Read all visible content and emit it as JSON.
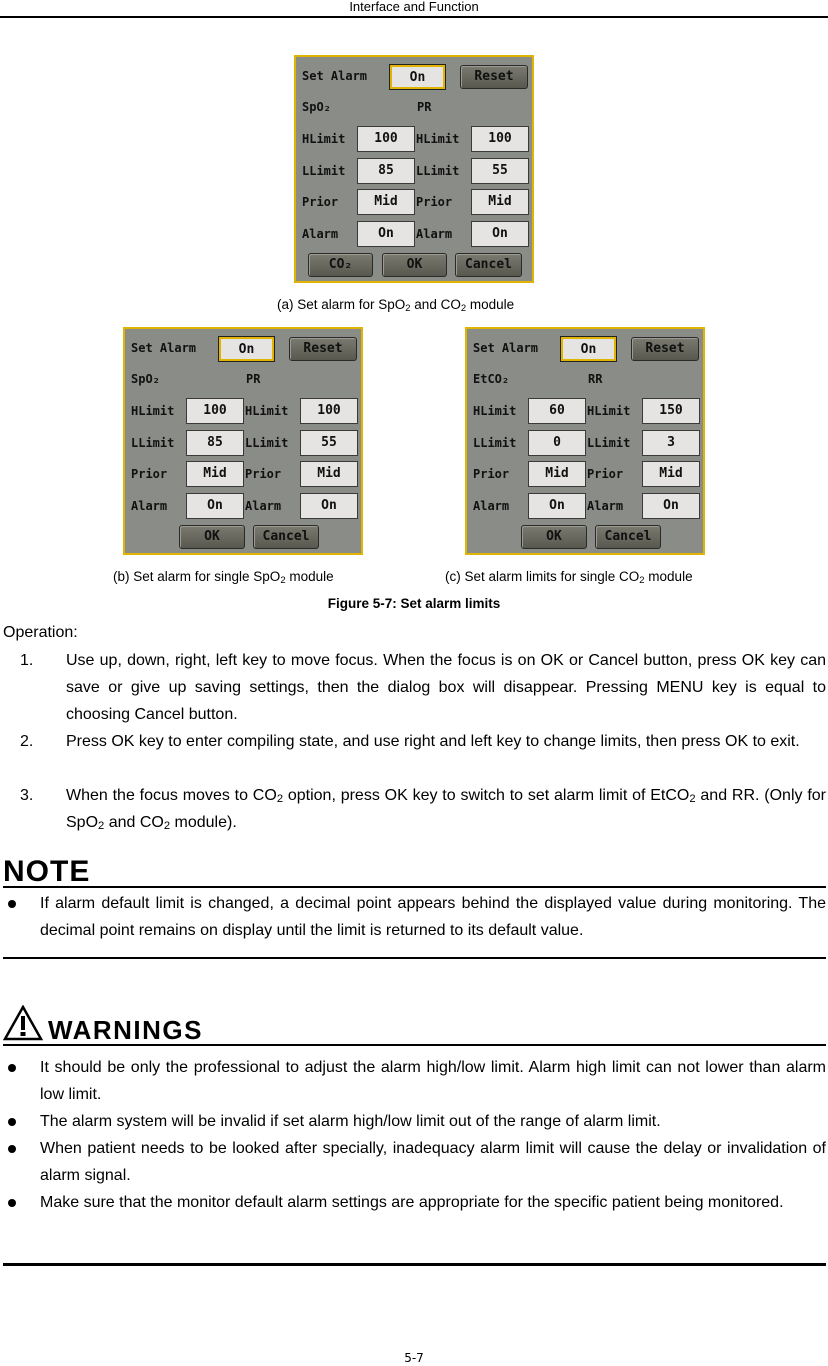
{
  "header": {
    "title": "Interface and Function"
  },
  "dialogs": {
    "a": {
      "set_alarm_label": "Set Alarm",
      "set_alarm_value": "On",
      "reset_label": "Reset",
      "left_param": "SpO₂",
      "right_param": "PR",
      "hlimit_label": "HLimit",
      "llimit_label": "LLimit",
      "prior_label": "Prior",
      "alarm_label": "Alarm",
      "left": {
        "hlimit": "100",
        "llimit": "85",
        "prior": "Mid",
        "alarm": "On"
      },
      "right": {
        "hlimit": "100",
        "llimit": "55",
        "prior": "Mid",
        "alarm": "On"
      },
      "co2_label": "CO₂",
      "ok_label": "OK",
      "cancel_label": "Cancel"
    },
    "b": {
      "set_alarm_label": "Set Alarm",
      "set_alarm_value": "On",
      "reset_label": "Reset",
      "left_param": "SpO₂",
      "right_param": "PR",
      "hlimit_label": "HLimit",
      "llimit_label": "LLimit",
      "prior_label": "Prior",
      "alarm_label": "Alarm",
      "left": {
        "hlimit": "100",
        "llimit": "85",
        "prior": "Mid",
        "alarm": "On"
      },
      "right": {
        "hlimit": "100",
        "llimit": "55",
        "prior": "Mid",
        "alarm": "On"
      },
      "ok_label": "OK",
      "cancel_label": "Cancel"
    },
    "c": {
      "set_alarm_label": "Set Alarm",
      "set_alarm_value": "On",
      "reset_label": "Reset",
      "left_param": "EtCO₂",
      "right_param": "RR",
      "hlimit_label": "HLimit",
      "llimit_label": "LLimit",
      "prior_label": "Prior",
      "alarm_label": "Alarm",
      "left": {
        "hlimit": "60",
        "llimit": "0",
        "prior": "Mid",
        "alarm": "On"
      },
      "right": {
        "hlimit": "150",
        "llimit": "3",
        "prior": "Mid",
        "alarm": "On"
      },
      "ok_label": "OK",
      "cancel_label": "Cancel"
    }
  },
  "captions": {
    "a": {
      "pre": "(a) Set alarm for SpO",
      "sub1": "2",
      "mid": " and CO",
      "sub2": "2",
      "post": " module"
    },
    "b": {
      "pre": "(b) Set alarm for single SpO",
      "sub1": "2",
      "post": " module"
    },
    "c": {
      "pre": "(c) Set alarm limits for single CO",
      "sub1": "2",
      "post": " module"
    }
  },
  "figure_title": "Figure 5-7: Set alarm limits",
  "operation": {
    "heading": "Operation:",
    "steps": [
      {
        "num": "1.",
        "text": "Use up, down, right, left key to move focus. When the focus is on OK or Cancel button, press OK key can save or give up saving settings, then the dialog box will disappear. Pressing MENU key is equal to choosing Cancel button."
      },
      {
        "num": "2.",
        "text": "Press OK key to enter compiling state, and use right and left key to change limits, then press OK to exit."
      },
      {
        "num": "3.",
        "text_pre": "When the focus moves to CO",
        "sub1": "2",
        "text_mid": " option, press OK key to switch to set alarm limit of EtCO",
        "sub2": "2",
        "text_mid2": " and RR. (Only for SpO",
        "sub3": "2",
        "text_mid3": " and CO",
        "sub4": "2",
        "text_post": " module)."
      }
    ]
  },
  "note": {
    "title": "NOTE",
    "items": [
      "If alarm default limit is changed, a decimal point appears behind the displayed value during monitoring. The decimal point remains on display until the limit is returned to its default value."
    ]
  },
  "warnings": {
    "title": "WARNINGS",
    "items": [
      "It should be only the professional to adjust the alarm high/low limit. Alarm high limit can not lower than alarm low limit.",
      "The alarm system will be invalid if set alarm high/low limit out of the range of alarm limit.",
      "When patient needs to be looked after specially, inadequacy alarm limit will cause the delay or invalidation of alarm signal.",
      "Make sure that the monitor default alarm settings are appropriate for the specific patient being monitored."
    ]
  },
  "footer": {
    "page_number": "5-7"
  }
}
